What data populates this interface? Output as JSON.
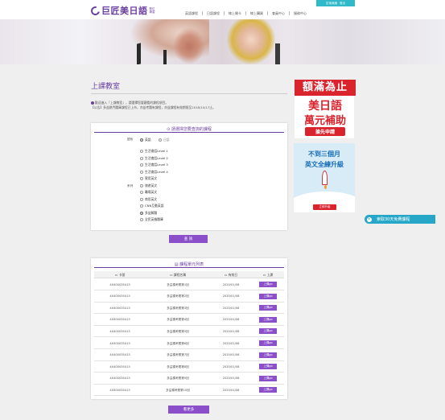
{
  "header": {
    "logo_text": "巨匠美日語",
    "logo_sub": "數位學習",
    "topbar": {
      "cart": "定後就緒",
      "login": "登出"
    },
    "nav": [
      "英語課程",
      "日語課程",
      "線上開卡",
      "線上購買",
      "會員中心",
      "服務中心"
    ]
  },
  "page": {
    "title": "上課教室",
    "welcome_line1": "歡迎進入『上課教室』，請選擇您要觀看的課程項目。",
    "welcome_line2": "【公告】多益熱門題庫課程已上市，亦益考題有課程，亦益課程有效期限至2018/10/17止。"
  },
  "filter": {
    "title": "請選擇您要查詢的課程",
    "lang_label": "語系",
    "lang_options": [
      "英語",
      "日語"
    ],
    "series_label": "系列",
    "series_options": [
      "生活會話Level 1",
      "生活會話Level 2",
      "生活會話Level 3",
      "生活會話Level 4",
      "實用英文",
      "旅遊英文",
      "職場英文",
      "商用英文",
      "CNN互動英語",
      "多益解題",
      "全民英檢題庫"
    ],
    "selected_series": "多益解題",
    "search_button": "查 詢"
  },
  "list": {
    "title": "課程單元列表",
    "columns": [
      "卡號",
      "課程名稱",
      "有效日",
      "上課"
    ],
    "rows": [
      {
        "card": "4X400035413",
        "name": "多益模考題第1回",
        "date": "2020/01/08",
        "action": "上課go"
      },
      {
        "card": "4X400035413",
        "name": "多益模考題第2回",
        "date": "2020/01/08",
        "action": "上課go"
      },
      {
        "card": "4X400035413",
        "name": "多益模考題第3回",
        "date": "2020/01/08",
        "action": "上課go"
      },
      {
        "card": "4X400035413",
        "name": "多益模考題第4回",
        "date": "2020/01/08",
        "action": "上課go"
      },
      {
        "card": "4X400035413",
        "name": "多益模考題第5回",
        "date": "2020/01/08",
        "action": "上課go"
      },
      {
        "card": "4X400035413",
        "name": "多益模考題第6回",
        "date": "2020/01/08",
        "action": "上課go"
      },
      {
        "card": "4X400035413",
        "name": "多益模考題第7回",
        "date": "2020/01/08",
        "action": "上課go"
      },
      {
        "card": "4X400035413",
        "name": "多益模考題第8回",
        "date": "2020/01/08",
        "action": "上課go"
      },
      {
        "card": "4X400035413",
        "name": "多益模考題第9回",
        "date": "2020/01/08",
        "action": "上課go"
      },
      {
        "card": "4X400035413",
        "name": "多益模考題第10回",
        "date": "2020/01/08",
        "action": "上課go"
      }
    ],
    "more_button": "看更多"
  },
  "ads": {
    "ad1_top": "額滿為止",
    "ad1_line1": "美日語",
    "ad1_line2": "萬元補助",
    "ad1_cta": "搶先申請",
    "ad2_line1": "不到三個月",
    "ad2_line2": "英文全練升級",
    "ad2_cta": "立即升級"
  },
  "trial": {
    "label": "索取30天免費課程"
  },
  "colors": {
    "accent": "#8a4fc9",
    "brand": "#6b3fa0",
    "teal": "#27a7c7",
    "ad_red": "#d9232d"
  }
}
